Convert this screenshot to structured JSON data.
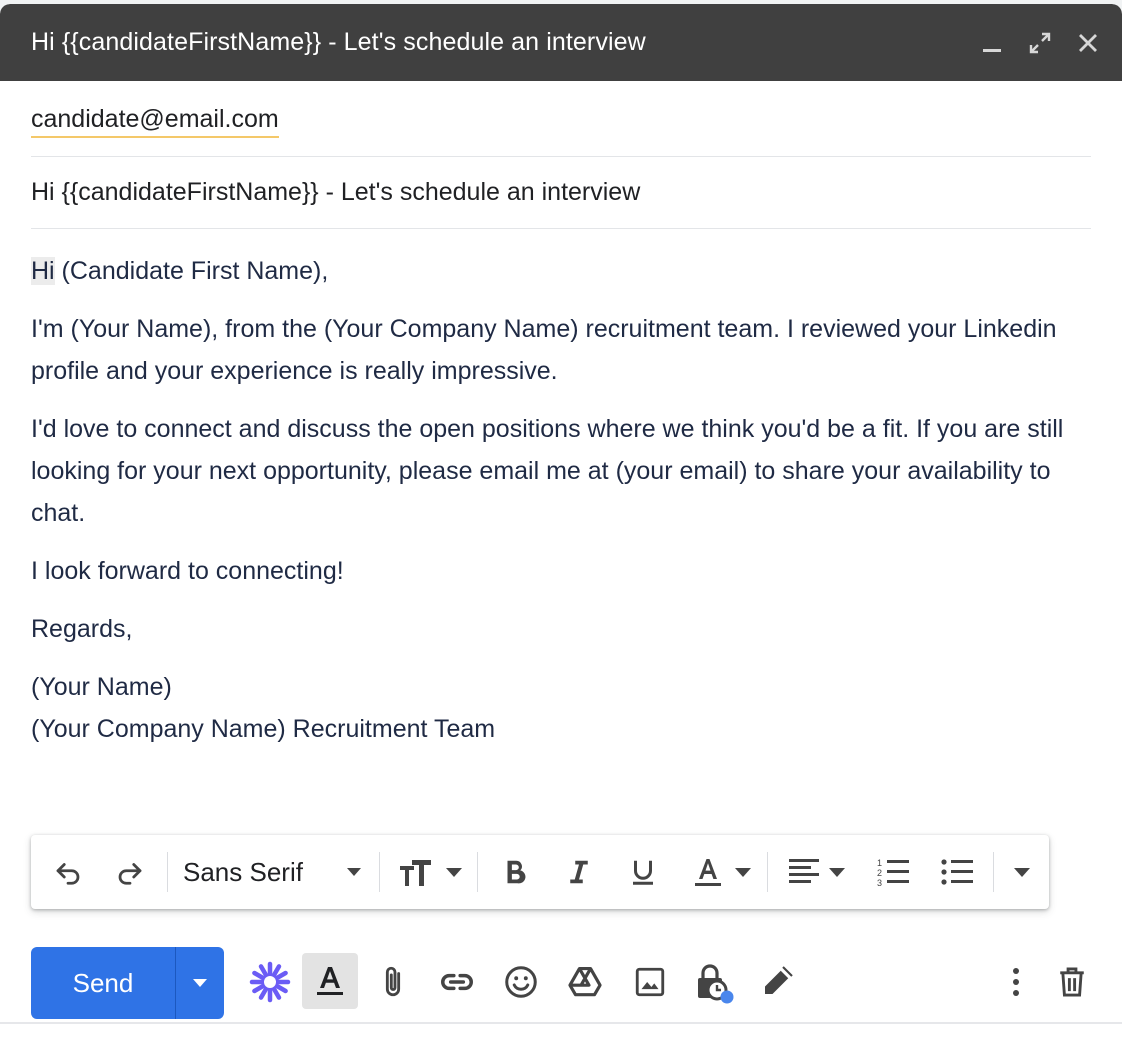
{
  "window": {
    "title": "Hi {{candidateFirstName}} - Let's schedule an interview",
    "controls": [
      "minimize-icon",
      "expand-icon",
      "close-icon"
    ]
  },
  "recipient": {
    "to": "candidate@email.com"
  },
  "subject": "Hi {{candidateFirstName}} - Let's schedule an interview",
  "body": {
    "greeting_hi": "Hi",
    "greeting_rest": " (Candidate First Name),",
    "para1": "I'm (Your Name), from the (Your Company Name) recruitment team. I reviewed your Linkedin profile and your experience is really impressive.",
    "para2": "I'd love to connect and discuss the open positions where we think you'd be a fit. If you are still looking for your next opportunity, please email me at (your email) to share your availability to chat.",
    "para3": "I look forward to connecting!",
    "closing": "Regards,",
    "sig_line1": "(Your Name)",
    "sig_line2": "(Your Company Name) Recruitment Team"
  },
  "format_toolbar": {
    "font": "Sans Serif",
    "tools": [
      "undo-icon",
      "redo-icon",
      "font-select",
      "text-size-icon",
      "bold-icon",
      "italic-icon",
      "underline-icon",
      "text-color-icon",
      "align-icon",
      "numbered-list-icon",
      "bulleted-list-icon",
      "more-formatting-icon"
    ]
  },
  "actions": {
    "send_label": "Send",
    "icons": [
      "send-options-icon",
      "ai-sparkle-icon",
      "formatting-options-icon",
      "attach-icon",
      "link-icon",
      "emoji-icon",
      "drive-icon",
      "photo-icon",
      "confidential-mode-icon",
      "signature-icon",
      "more-options-icon",
      "discard-icon"
    ]
  },
  "colors": {
    "titlebar": "#404040",
    "send": "#2f73e6",
    "sparkle": "#6b5cf5",
    "body_text": "#1f2a44",
    "chip_underline": "#f4c869",
    "badge_dot": "#4a86ec"
  }
}
